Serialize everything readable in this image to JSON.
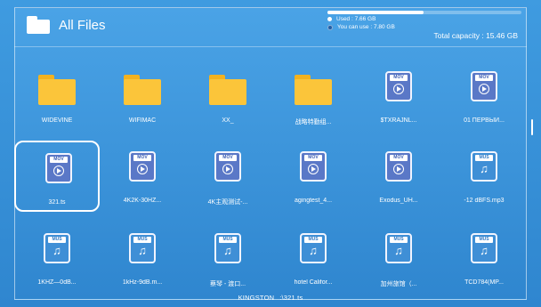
{
  "header": {
    "title": "All Files",
    "storage": {
      "used_label": "Used : 7.66 GB",
      "free_label": "You can use : 7.80 GB",
      "total_label": "Total capacity : 15.46 GB",
      "used_fraction": 0.495
    }
  },
  "items": [
    {
      "type": "folder",
      "label": "WIDEVINE"
    },
    {
      "type": "folder",
      "label": "WIFIMAC"
    },
    {
      "type": "folder",
      "label": "XX_"
    },
    {
      "type": "folder",
      "label": "战略特勤组..."
    },
    {
      "type": "mov",
      "tag": "MOV",
      "label": "$TXRAJNL..."
    },
    {
      "type": "mov",
      "tag": "MOV",
      "label": "01 ПЕРВЫЙ..."
    },
    {
      "type": "mov",
      "tag": "MOV",
      "label": "321.ts",
      "selected": true
    },
    {
      "type": "mov",
      "tag": "MOV",
      "label": "4K2K-30HZ..."
    },
    {
      "type": "mov",
      "tag": "MOV",
      "label": "4K主观测试-..."
    },
    {
      "type": "mov",
      "tag": "MOV",
      "label": "agingtest_4..."
    },
    {
      "type": "mov",
      "tag": "MOV",
      "label": "Exodus_UH..."
    },
    {
      "type": "mus",
      "tag": "MUS",
      "label": "-12 dBFS.mp3"
    },
    {
      "type": "mus",
      "tag": "MUS",
      "label": "1KHZ—0dB..."
    },
    {
      "type": "mus",
      "tag": "MUS",
      "label": "1kHz-9dB.m..."
    },
    {
      "type": "mus",
      "tag": "MUS",
      "label": "蔡琴 - 渡口..."
    },
    {
      "type": "mus",
      "tag": "MUS",
      "label": "hotel Califor..."
    },
    {
      "type": "mus",
      "tag": "MUS",
      "label": "加州旅馆（..."
    },
    {
      "type": "mus",
      "tag": "MUS",
      "label": "TCD784(MP..."
    }
  ],
  "footer": {
    "device": "KINGSTON",
    "path": ":\\321.ts"
  },
  "icons": {
    "folder": "folder-icon",
    "mov": "video-file-icon",
    "mus": "music-file-icon"
  }
}
